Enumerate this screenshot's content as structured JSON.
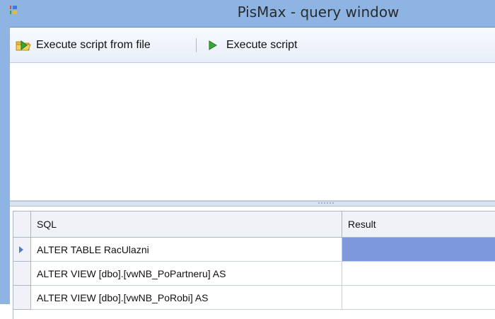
{
  "window": {
    "title": "PisMax - query window"
  },
  "toolbar": {
    "execute_from_file_label": "Execute script from file",
    "execute_label": "Execute script",
    "icons": {
      "execute_from_file": "folder-play-icon",
      "execute": "play-icon"
    }
  },
  "grid": {
    "columns": [
      "SQL",
      "Result"
    ],
    "rows": [
      {
        "sql": "ALTER TABLE RacUlazni",
        "result": "",
        "selected": true
      },
      {
        "sql": "ALTER VIEW [dbo].[vwNB_PoPartneru] AS",
        "result": "",
        "selected": false
      },
      {
        "sql": "ALTER VIEW [dbo].[vwNB_PoRobi] AS",
        "result": "",
        "selected": false
      }
    ]
  },
  "colors": {
    "titlebar": "#8db4e2",
    "selected_cell": "#7e98dd",
    "play_green": "#3aa33a",
    "folder_yellow": "#e8b93a"
  }
}
